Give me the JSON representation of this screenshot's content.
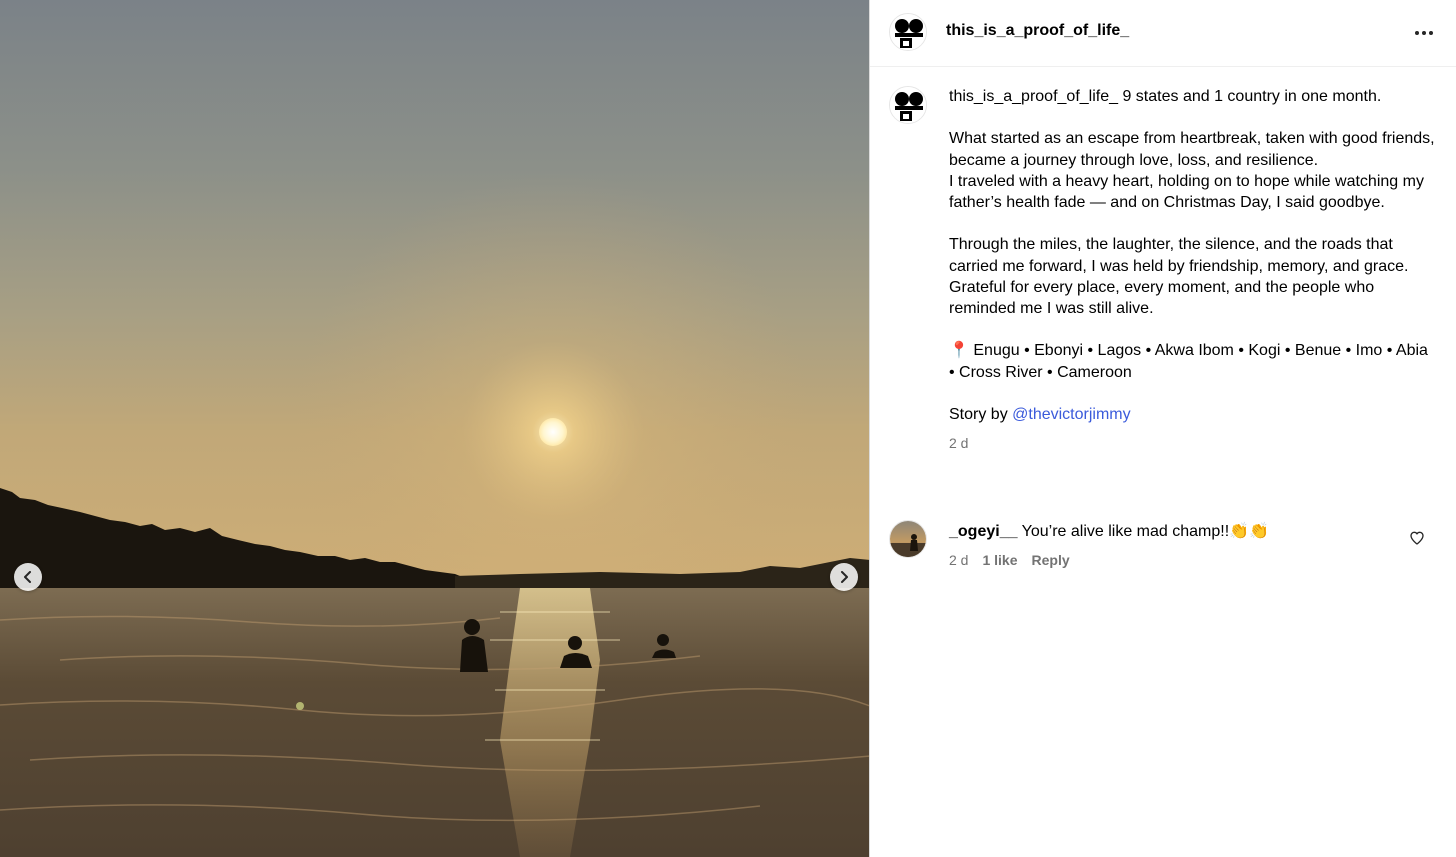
{
  "post": {
    "username": "this_is_a_proof_of_life_",
    "more_icon": "more-horizontal-icon"
  },
  "caption": {
    "username": "this_is_a_proof_of_life_",
    "headline": " 9 states and 1 country in one month.",
    "para1_line1": "What started as an escape from heartbreak, taken with good friends, became a journey through love, loss, and resilience.",
    "para1_line2": "I traveled with a heavy heart, holding on to hope while watching my father’s health fade — and on Christmas Day, I said goodbye.",
    "para2_line1": "Through the miles, the laughter, the silence, and the roads that carried me forward, I was held by friendship, memory, and grace.",
    "para2_line2": "Grateful for every place, every moment, and the people who reminded me I was still alive.",
    "pin_emoji": "📍",
    "places": " Enugu • Ebonyi • Lagos • Akwa Ibom • Kogi • Benue • Imo • Abia • Cross River • Cameroon",
    "story_prefix": "Story by ",
    "story_mention": "@thevictorjimmy",
    "time": "2 d"
  },
  "comment": {
    "username": "_ogeyi__",
    "text": " You’re alive like mad champ!!👏👏",
    "time": "2 d",
    "likes": "1 like",
    "reply": "Reply"
  },
  "colors": {
    "mention": "#3b5bdb",
    "secondary_text": "#737373",
    "divider": "#efefef"
  }
}
